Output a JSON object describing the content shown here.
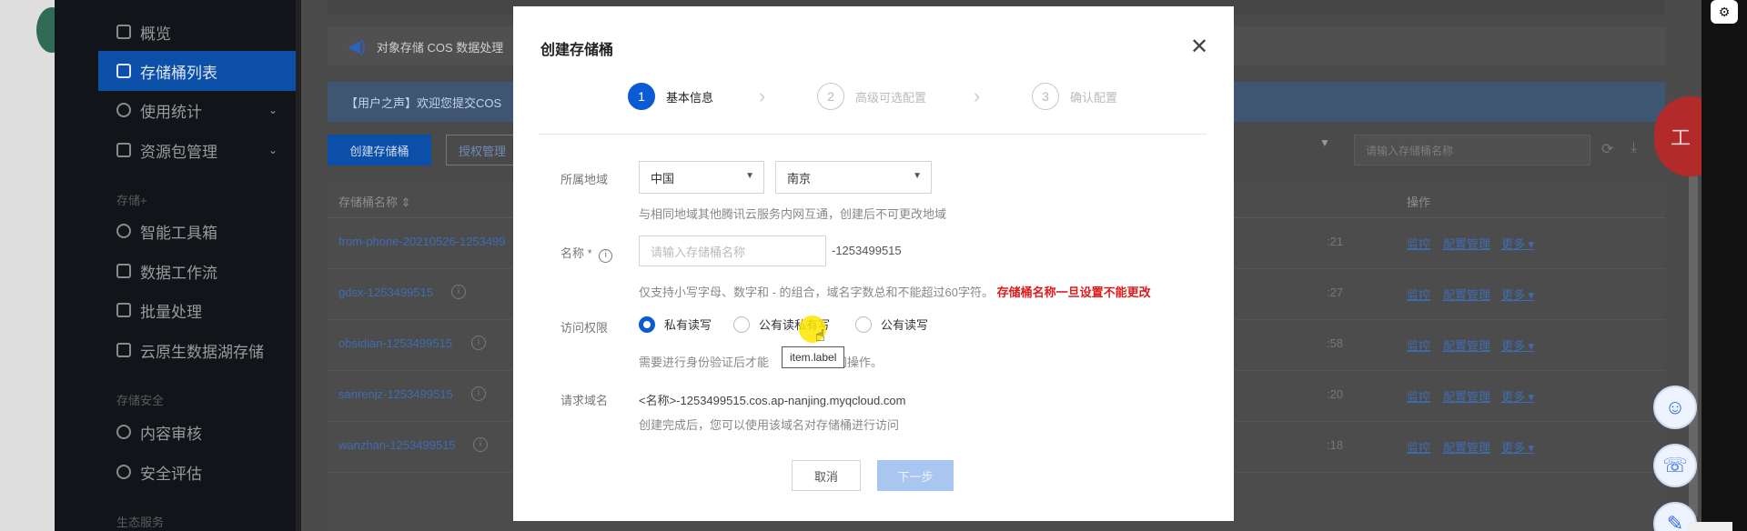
{
  "sidebar": {
    "items": [
      {
        "label": "概览",
        "icon": "grid-icon"
      },
      {
        "label": "存储桶列表",
        "icon": "bucket-icon"
      },
      {
        "label": "使用统计",
        "icon": "chart-icon"
      },
      {
        "label": "资源包管理",
        "icon": "package-icon"
      },
      {
        "label": "智能工具箱",
        "icon": "toolbox-icon"
      },
      {
        "label": "数据工作流",
        "icon": "workflow-icon"
      },
      {
        "label": "批量处理",
        "icon": "batch-icon"
      },
      {
        "label": "云原生数据湖存储",
        "icon": "lake-icon"
      },
      {
        "label": "内容审核",
        "icon": "audit-icon"
      },
      {
        "label": "安全评估",
        "icon": "security-icon"
      }
    ],
    "sections": [
      "存储+",
      "存储安全",
      "生态服务"
    ]
  },
  "main": {
    "notice": "对象存储 COS 数据处理",
    "user_voice": "【用户之声】欢迎您提交COS",
    "create_button": "创建存储桶",
    "grant_button": "授权管理",
    "search_placeholder": "请输入存储桶名称",
    "table": {
      "col_name": "存储桶名称 ⇕",
      "col_op": "操作",
      "rows": [
        {
          "name": "from-phone-20210526-1253499",
          "tail": ":21"
        },
        {
          "name": "gdsx-1253499515",
          "tail": ":27"
        },
        {
          "name": "obsidian-1253499515",
          "tail": ":58"
        },
        {
          "name": "sanrenjz-1253499515",
          "tail": ":20"
        },
        {
          "name": "wanzhan-1253499515",
          "tail": ":18"
        }
      ],
      "ops": [
        "监控",
        "配置管理",
        "更多 ▾"
      ]
    }
  },
  "modal": {
    "title": "创建存储桶",
    "steps": [
      {
        "num": "1",
        "label": "基本信息"
      },
      {
        "num": "2",
        "label": "高级可选配置"
      },
      {
        "num": "3",
        "label": "确认配置"
      }
    ],
    "region": {
      "label": "所属地域",
      "country": "中国",
      "city": "南京",
      "hint": "与相同地域其他腾讯云服务内网互通，创建后不可更改地域"
    },
    "name": {
      "label": "名称 *",
      "placeholder": "请输入存储桶名称",
      "suffix": "-1253499515",
      "hint": "仅支持小写字母、数字和 - 的组合，域名字数总和不能超过60字符。",
      "warning": "存储桶名称一旦设置不能更改"
    },
    "access": {
      "label": "访问权限",
      "options": [
        "私有读写",
        "公有读私有写",
        "公有读写"
      ],
      "hint_pre": "需要进行身份验证后才能",
      "hint_post": "访问操作。",
      "tooltip": "item.label"
    },
    "domain": {
      "label": "请求域名",
      "value": "<名称>-1253499515.cos.ap-nanjing.myqcloud.com",
      "hint": "创建完成后，您可以使用该域名对存储桶进行访问"
    },
    "cancel": "取消",
    "next": "下一步"
  },
  "floating": {
    "badge": "工",
    "right_top_icon": "⚙"
  }
}
